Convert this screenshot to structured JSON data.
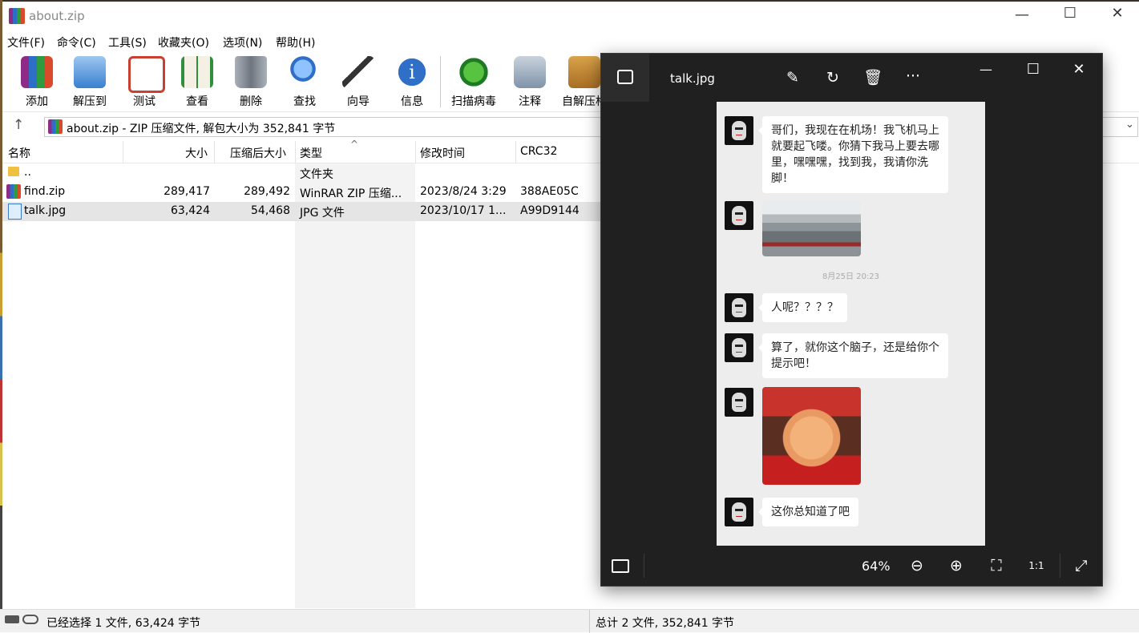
{
  "winrar": {
    "title": "about.zip",
    "menu": [
      "文件(F)",
      "命令(C)",
      "工具(S)",
      "收藏夹(O)",
      "选项(N)",
      "帮助(H)"
    ],
    "toolbar": [
      {
        "label": "添加",
        "icon": "add-archive-icon",
        "color": "#b53b8c"
      },
      {
        "label": "解压到",
        "icon": "extract-folder-icon",
        "color": "#4a90d9"
      },
      {
        "label": "测试",
        "icon": "test-clipboard-icon",
        "color": "#d04434"
      },
      {
        "label": "查看",
        "icon": "view-book-icon",
        "color": "#2f8f3c"
      },
      {
        "label": "删除",
        "icon": "trash-icon",
        "color": "#8a8f99"
      },
      {
        "label": "查找",
        "icon": "magnifier-icon",
        "color": "#3a7bd5"
      },
      {
        "label": "向导",
        "icon": "magic-wand-icon",
        "color": "#4b4b4b"
      },
      {
        "label": "信息",
        "icon": "info-icon",
        "color": "#2f6fc7"
      },
      {
        "label": "扫描病毒",
        "icon": "virus-scan-icon",
        "color": "#3aa13a"
      },
      {
        "label": "注释",
        "icon": "comment-icon",
        "color": "#7f93a8"
      },
      {
        "label": "自解压格",
        "icon": "sfx-box-icon",
        "color": "#c9893a"
      }
    ],
    "address": "about.zip - ZIP 压缩文件, 解包大小为 352,841 字节",
    "columns": [
      "名称",
      "大小",
      "压缩后大小",
      "类型",
      "修改时间",
      "CRC32"
    ],
    "rows": [
      {
        "name": "..",
        "size": "",
        "packed": "",
        "type": "文件夹",
        "modified": "",
        "crc": "",
        "icon": "folder-icon"
      },
      {
        "name": "find.zip",
        "size": "289,417",
        "packed": "289,492",
        "type": "WinRAR ZIP 压缩...",
        "modified": "2023/8/24 3:29",
        "crc": "388AE05C",
        "icon": "zip-archive-icon"
      },
      {
        "name": "talk.jpg",
        "size": "63,424",
        "packed": "54,468",
        "type": "JPG 文件",
        "modified": "2023/10/17 1...",
        "crc": "A99D9144",
        "icon": "jpg-image-icon"
      }
    ],
    "status_left": "已经选择 1 文件, 63,424 字节",
    "status_right": "总计 2 文件, 352,841 字节"
  },
  "viewer": {
    "title": "talk.jpg",
    "zoom": "64%",
    "chat": {
      "messages": [
        {
          "kind": "text",
          "text": "哥们，我现在在机场！我飞机马上就要起飞喽。你猜下我马上要去哪里，嘿嘿嘿，找到我，我请你洗脚！"
        },
        {
          "kind": "image",
          "desc": "airport-photo"
        },
        {
          "kind": "time",
          "text": "8月25日 20:23"
        },
        {
          "kind": "text",
          "text": "人呢？？？？"
        },
        {
          "kind": "text",
          "text": "算了，就你这个脑子，还是给你个提示吧！"
        },
        {
          "kind": "image",
          "desc": "pig-sticker"
        },
        {
          "kind": "text",
          "text": "这你总知道了吧"
        }
      ]
    }
  }
}
